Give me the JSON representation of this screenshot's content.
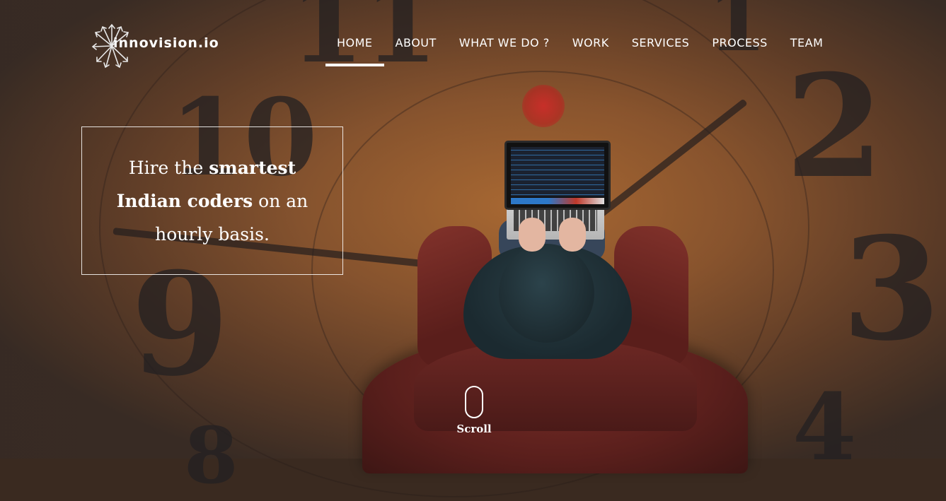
{
  "brand": {
    "name": "innovision.io",
    "logo_icon": "arrows-burst-icon"
  },
  "nav": {
    "items": [
      {
        "label": "HOME",
        "active": true
      },
      {
        "label": "ABOUT",
        "active": false
      },
      {
        "label": "WHAT WE DO ?",
        "active": false
      },
      {
        "label": "WORK",
        "active": false
      },
      {
        "label": "SERVICES",
        "active": false
      },
      {
        "label": "PROCESS",
        "active": false
      },
      {
        "label": "TEAM",
        "active": false
      }
    ]
  },
  "hero": {
    "tagline_part1": "Hire the ",
    "tagline_bold1": "smartest",
    "tagline_bold2": "Indian coders",
    "tagline_part2": " on an",
    "tagline_part3": "hourly basis.",
    "clock_numerals": [
      "10",
      "9",
      "2",
      "3",
      "11",
      "1",
      "4",
      "8"
    ]
  },
  "scroll": {
    "label": "Scroll",
    "icon": "mouse-icon"
  },
  "colors": {
    "text": "#ffffff",
    "accent_border": "#ffffff"
  }
}
